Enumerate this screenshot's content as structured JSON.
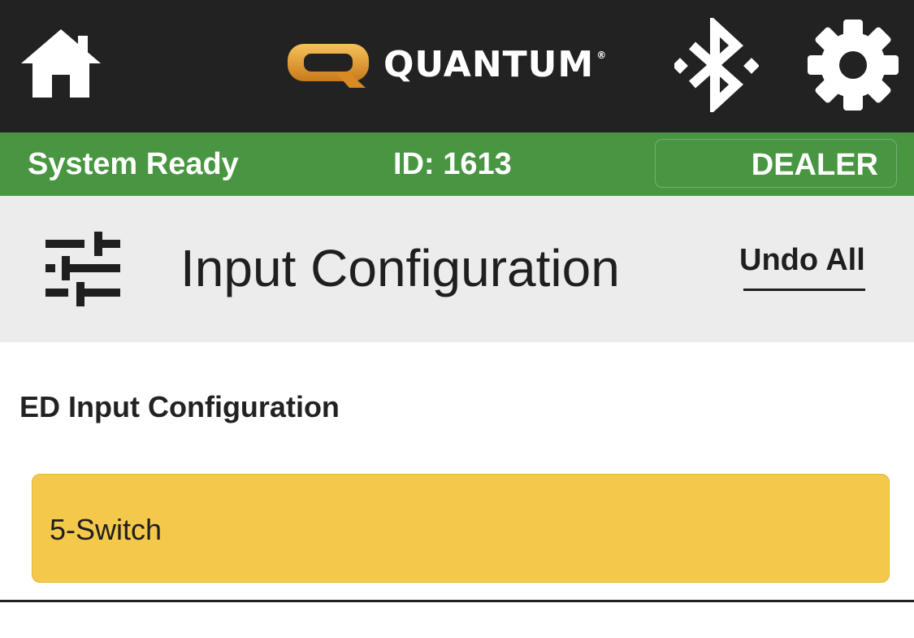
{
  "topbar": {
    "home_icon": "home-icon",
    "logo": {
      "letter": "Q",
      "text": "QUANTUM",
      "mark": "®"
    },
    "bluetooth_icon": "bluetooth-icon",
    "settings_icon": "gear-icon"
  },
  "status_bar": {
    "status": "System Ready",
    "id": "ID: 1613",
    "mode_label": "DEALER",
    "color": "#489641"
  },
  "page_header": {
    "icon": "sliders-icon",
    "title": "Input Configuration",
    "undo_label": "Undo All"
  },
  "content": {
    "section_title": "ED Input Configuration",
    "selected_value": "5-Switch",
    "field_color": "#f4c84a"
  }
}
